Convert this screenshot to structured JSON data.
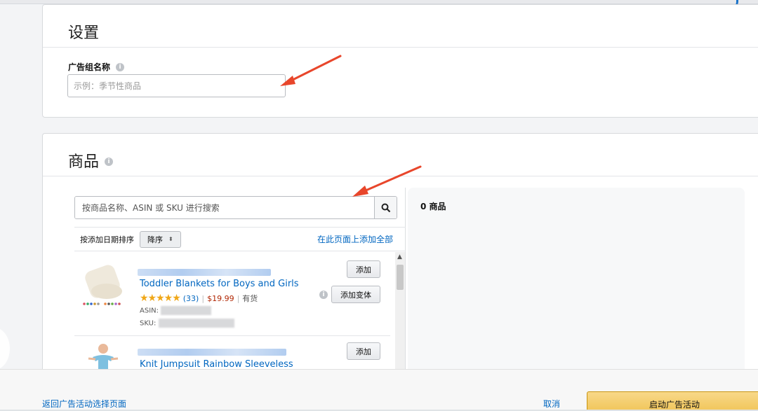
{
  "settings": {
    "title": "设置",
    "ad_group_label": "广告组名称",
    "ad_group_placeholder": "示例：季节性商品"
  },
  "products": {
    "title": "商品",
    "search_placeholder": "按商品名称、ASIN 或 SKU 进行搜索",
    "sort_label": "按添加日期排序",
    "sort_value": "降序",
    "add_all_link": "在此页面上添加全部",
    "selected_count": "0 商品",
    "items": [
      {
        "title": "Toddler Blankets for Boys and Girls",
        "stars": "★★★★★",
        "rating": 4.5,
        "review_count": "(33)",
        "price": "$19.99",
        "stock": "有货",
        "asin_label": "ASIN:",
        "sku_label": "SKU:",
        "add_button": "添加",
        "add_variations_button": "添加变体"
      },
      {
        "title": "Knit Jumpsuit Rainbow Sleeveless",
        "add_button": "添加"
      }
    ]
  },
  "footer": {
    "back_link": "返回广告活动选择页面",
    "cancel_link": "取消",
    "launch_button": "启动广告活动"
  },
  "colors": {
    "link": "#0066c0",
    "price": "#b12704",
    "star": "#f0a718",
    "annotation_arrow": "#e8462b",
    "primary_button": "#efc14e"
  }
}
